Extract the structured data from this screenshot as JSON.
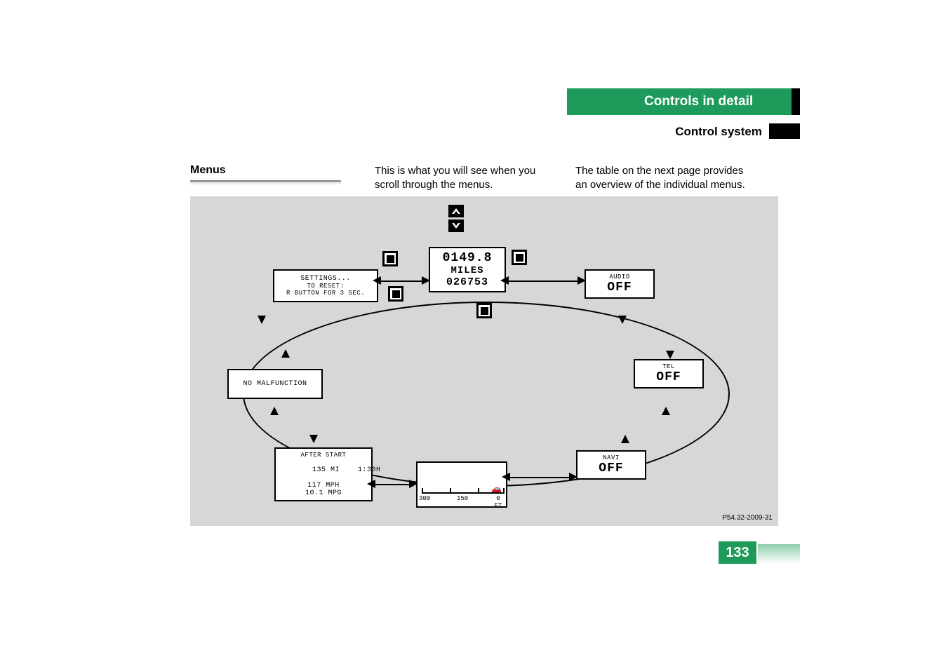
{
  "header": {
    "tab1": "Controls in detail",
    "tab2": "Control system"
  },
  "section_title": "Menus",
  "body": {
    "col1": "This is what you will see when you scroll through the menus.",
    "col2": "The table on the next page provides an overview of the individual menus."
  },
  "figure": {
    "caption": "P54.32-2009-31",
    "screens": {
      "settings": {
        "line1": "SETTINGS...",
        "line2": "TO RESET:",
        "line3": "R BUTTON FOR 3 SEC."
      },
      "trip": {
        "line1": "0149.8",
        "line2": "MILES",
        "line3": "026753"
      },
      "audio": {
        "line1": "AUDIO",
        "line2": "OFF"
      },
      "malfunction": {
        "line1": "NO MALFUNCTION"
      },
      "tel": {
        "line1": "TEL",
        "line2": "OFF"
      },
      "navi": {
        "line1": "NAVI",
        "line2": "OFF"
      },
      "trip_computer": {
        "line1": "AFTER START",
        "line2_left": "135 MI",
        "line2_right": "1:30H",
        "line3": "117 MPH",
        "line4": "10.1 MPG"
      },
      "distance": {
        "t1": "300",
        "t2": "150",
        "unit": "0 FT"
      }
    }
  },
  "page_number": "133"
}
